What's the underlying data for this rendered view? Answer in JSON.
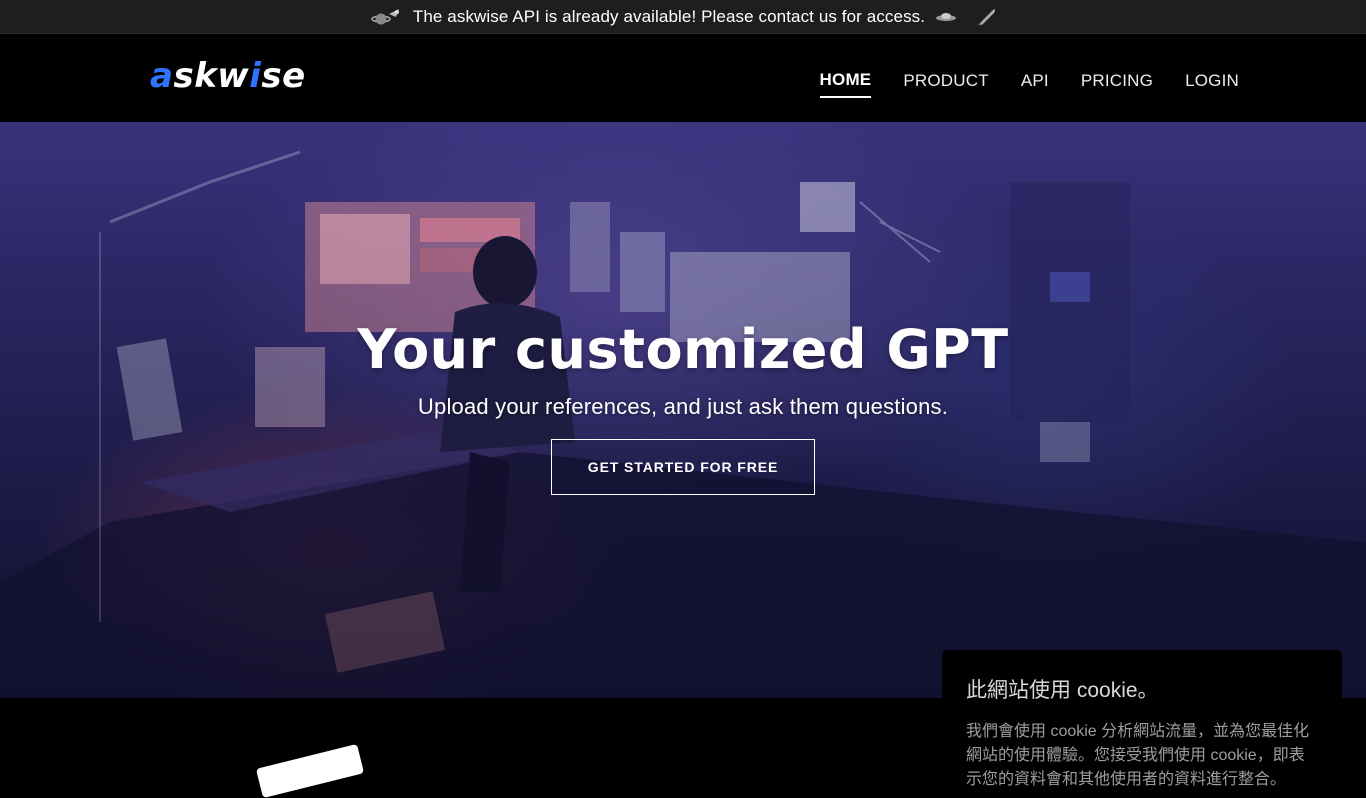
{
  "announcement": {
    "text": "The askwise API is already available! Please contact us for access.",
    "left_icon": "planet-icon",
    "right_icons": [
      "flying-saucer-icon",
      "rocket-icon"
    ]
  },
  "header": {
    "logo_a": "a",
    "logo_skw": "skw",
    "logo_i": "i",
    "logo_se": "se",
    "nav": {
      "home": "HOME",
      "product": "PRODUCT",
      "api": "API",
      "pricing": "PRICING",
      "login": "LOGIN"
    }
  },
  "hero": {
    "title": "Your customized GPT",
    "subtitle": "Upload your references, and just ask them questions.",
    "cta": "GET STARTED FOR FREE"
  },
  "cookie": {
    "title": "此網站使用 cookie。",
    "text": "我們會使用 cookie 分析網站流量，並為您最佳化網站的使用體驗。您接受我們使用 cookie，即表示您的資料會和其他使用者的資料進行整合。"
  },
  "colors": {
    "accent": "#2f73ff",
    "header_bg": "#000000",
    "announce_bg": "#1e1e1e"
  }
}
